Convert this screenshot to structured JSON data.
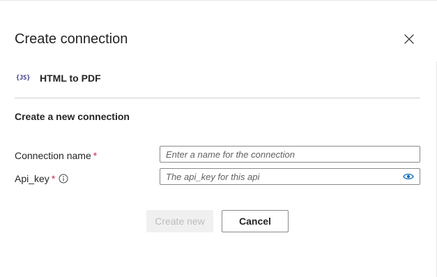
{
  "dialog": {
    "title": "Create connection",
    "close_icon": "close-icon"
  },
  "connector": {
    "logo_text": "{JS}",
    "name": "HTML to PDF"
  },
  "section_title": "Create a new connection",
  "fields": {
    "connection_name": {
      "label": "Connection name",
      "required_marker": "*",
      "value": "",
      "placeholder": "Enter a name for the connection"
    },
    "api_key": {
      "label": "Api_key",
      "required_marker": "*",
      "info_icon": "info-icon",
      "value": "",
      "placeholder": "The api_key for this api",
      "reveal_icon": "eye-icon"
    }
  },
  "buttons": {
    "create_label": "Create new",
    "cancel_label": "Cancel"
  },
  "colors": {
    "required": "#c4314b",
    "accent": "#0f6cbd",
    "logo": "#3b3a8c",
    "disabled_text": "#bdbdbd"
  }
}
